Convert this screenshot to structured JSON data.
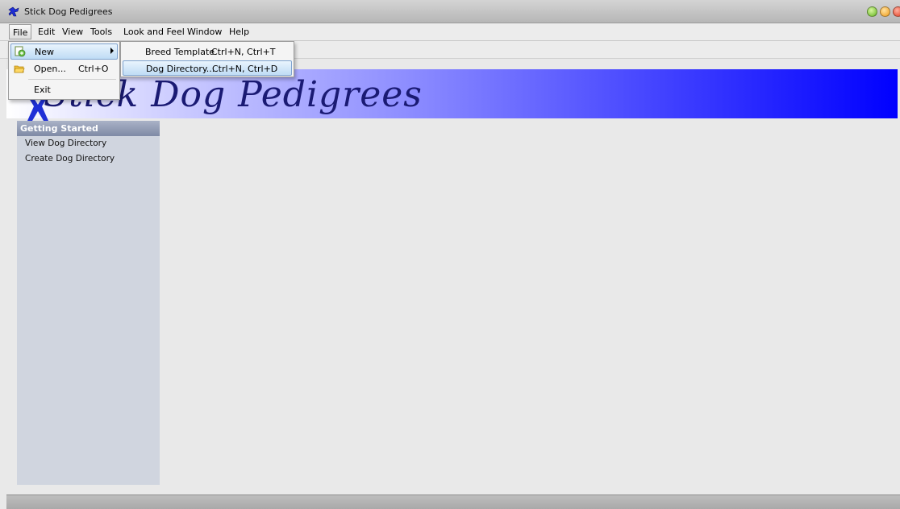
{
  "window": {
    "title": "Stick Dog Pedigrees"
  },
  "menubar": {
    "items": [
      "File",
      "Edit",
      "View",
      "Tools",
      "Look and Feel",
      "Window",
      "Help"
    ]
  },
  "file_menu": {
    "items": [
      {
        "label": "New",
        "accel": ""
      },
      {
        "label": "Open...",
        "accel": "Ctrl+O"
      },
      {
        "label": "Exit",
        "accel": ""
      }
    ]
  },
  "new_submenu": {
    "items": [
      {
        "label": "Breed Template",
        "accel": "Ctrl+N, Ctrl+T"
      },
      {
        "label": "Dog Directory...",
        "accel": "Ctrl+N, Ctrl+D"
      }
    ]
  },
  "banner": {
    "title": "Stick Dog Pedigrees"
  },
  "sidebar": {
    "header": "Getting Started",
    "items": [
      "View Dog Directory",
      "Create Dog Directory"
    ]
  },
  "colors": {
    "banner_end": "#0000ff",
    "sidebar_bg": "#d0d5df",
    "selection": "#bfdcf5"
  }
}
